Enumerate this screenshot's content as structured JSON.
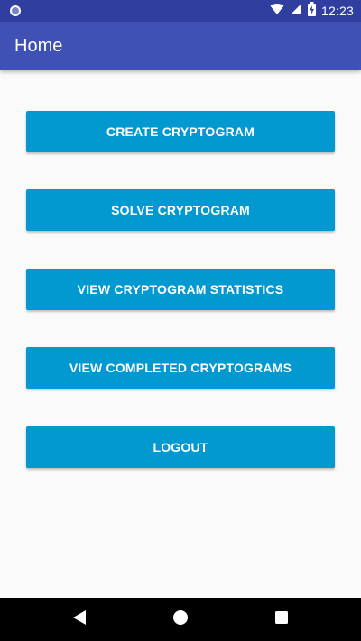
{
  "status_bar": {
    "time": "12:23",
    "icons": [
      "circle-notification-icon",
      "wifi-icon",
      "cellular-signal-icon",
      "battery-charging-icon"
    ]
  },
  "app_bar": {
    "title": "Home"
  },
  "menu": {
    "buttons": [
      {
        "label": "CREATE CRYPTOGRAM"
      },
      {
        "label": "SOLVE CRYPTOGRAM"
      },
      {
        "label": "VIEW CRYPTOGRAM STATISTICS"
      },
      {
        "label": "VIEW COMPLETED CRYPTOGRAMS"
      },
      {
        "label": "LOGOUT"
      }
    ]
  },
  "nav_bar": {
    "icons": [
      "back-icon",
      "home-icon",
      "recents-icon"
    ]
  },
  "colors": {
    "status_bar": "#303f9f",
    "app_bar": "#3f51b5",
    "button": "#0299d1",
    "background": "#fafafa"
  }
}
